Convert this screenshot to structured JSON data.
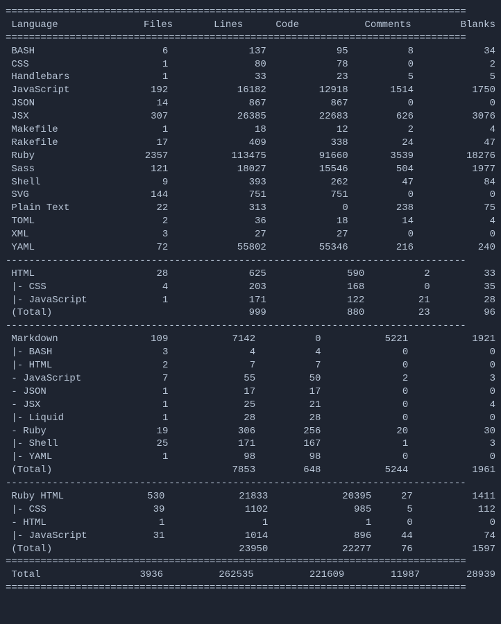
{
  "columns": [
    "Language",
    "Files",
    "Lines",
    "Code",
    "Comments",
    "Blanks"
  ],
  "sep_eq": "===============================================================================",
  "sep_dash": "-------------------------------------------------------------------------------",
  "sections": [
    {
      "rows": [
        {
          "label": "BASH",
          "files": 6,
          "lines": 137,
          "code": 95,
          "comments": 8,
          "blanks": 34
        },
        {
          "label": "CSS",
          "files": 1,
          "lines": 80,
          "code": 78,
          "comments": 0,
          "blanks": 2
        },
        {
          "label": "Handlebars",
          "files": 1,
          "lines": 33,
          "code": 23,
          "comments": 5,
          "blanks": 5
        },
        {
          "label": "JavaScript",
          "files": 192,
          "lines": 16182,
          "code": 12918,
          "comments": 1514,
          "blanks": 1750
        },
        {
          "label": "JSON",
          "files": 14,
          "lines": 867,
          "code": 867,
          "comments": 0,
          "blanks": 0
        },
        {
          "label": "JSX",
          "files": 307,
          "lines": 26385,
          "code": 22683,
          "comments": 626,
          "blanks": 3076
        },
        {
          "label": "Makefile",
          "files": 1,
          "lines": 18,
          "code": 12,
          "comments": 2,
          "blanks": 4
        },
        {
          "label": "Rakefile",
          "files": 17,
          "lines": 409,
          "code": 338,
          "comments": 24,
          "blanks": 47
        },
        {
          "label": "Ruby",
          "files": 2357,
          "lines": 113475,
          "code": 91660,
          "comments": 3539,
          "blanks": 18276
        },
        {
          "label": "Sass",
          "files": 121,
          "lines": 18027,
          "code": 15546,
          "comments": 504,
          "blanks": 1977
        },
        {
          "label": "Shell",
          "files": 9,
          "lines": 393,
          "code": 262,
          "comments": 47,
          "blanks": 84
        },
        {
          "label": "SVG",
          "files": 144,
          "lines": 751,
          "code": 751,
          "comments": 0,
          "blanks": 0
        },
        {
          "label": "Plain Text",
          "files": 22,
          "lines": 313,
          "code": 0,
          "comments": 238,
          "blanks": 75
        },
        {
          "label": "TOML",
          "files": 2,
          "lines": 36,
          "code": 18,
          "comments": 14,
          "blanks": 4
        },
        {
          "label": "XML",
          "files": 3,
          "lines": 27,
          "code": 27,
          "comments": 0,
          "blanks": 0
        },
        {
          "label": "YAML",
          "files": 72,
          "lines": 55802,
          "code": 55346,
          "comments": 216,
          "blanks": 240
        }
      ]
    },
    {
      "rows": [
        {
          "label": "HTML",
          "files": 28,
          "lines": 625,
          "code": 590,
          "comments": 2,
          "blanks": 33
        },
        {
          "label": "CSS",
          "indent": true,
          "files": 4,
          "lines": 203,
          "code": 168,
          "comments": 0,
          "blanks": 35
        },
        {
          "label": "JavaScript",
          "indent": true,
          "files": 1,
          "lines": 171,
          "code": 122,
          "comments": 21,
          "blanks": 28
        },
        {
          "label": "(Total)",
          "files": "",
          "lines": 999,
          "code": 880,
          "comments": 23,
          "blanks": 96
        }
      ]
    },
    {
      "rows": [
        {
          "label": "Markdown",
          "files": 109,
          "lines": 7142,
          "code": 0,
          "comments": 5221,
          "blanks": 1921
        },
        {
          "label": "BASH",
          "indent": true,
          "files": 3,
          "lines": 4,
          "code": 4,
          "comments": 0,
          "blanks": 0
        },
        {
          "label": "HTML",
          "indent": true,
          "files": 2,
          "lines": 7,
          "code": 7,
          "comments": 0,
          "blanks": 0
        },
        {
          "label": "JavaScript",
          "nest": true,
          "files": 7,
          "lines": 55,
          "code": 50,
          "comments": 2,
          "blanks": 3
        },
        {
          "label": "JSON",
          "nest": true,
          "files": 1,
          "lines": 17,
          "code": 17,
          "comments": 0,
          "blanks": 0
        },
        {
          "label": "JSX",
          "nest": true,
          "files": 1,
          "lines": 25,
          "code": 21,
          "comments": 0,
          "blanks": 4
        },
        {
          "label": "Liquid",
          "indent": true,
          "files": 1,
          "lines": 28,
          "code": 28,
          "comments": 0,
          "blanks": 0
        },
        {
          "label": "Ruby",
          "nest": true,
          "files": 19,
          "lines": 306,
          "code": 256,
          "comments": 20,
          "blanks": 30
        },
        {
          "label": "Shell",
          "indent": true,
          "files": 25,
          "lines": 171,
          "code": 167,
          "comments": 1,
          "blanks": 3
        },
        {
          "label": "YAML",
          "indent": true,
          "files": 1,
          "lines": 98,
          "code": 98,
          "comments": 0,
          "blanks": 0
        },
        {
          "label": "(Total)",
          "files": "",
          "lines": 7853,
          "code": 648,
          "comments": 5244,
          "blanks": 1961
        }
      ]
    },
    {
      "rows": [
        {
          "label": "Ruby HTML",
          "files": 530,
          "lines": 21833,
          "code": 20395,
          "comments": 27,
          "blanks": 1411
        },
        {
          "label": "CSS",
          "indent": true,
          "files": 39,
          "lines": 1102,
          "code": 985,
          "comments": 5,
          "blanks": 112
        },
        {
          "label": "HTML",
          "nest": true,
          "files": 1,
          "lines": 1,
          "code": 1,
          "comments": 0,
          "blanks": 0
        },
        {
          "label": "JavaScript",
          "indent": true,
          "files": 31,
          "lines": 1014,
          "code": 896,
          "comments": 44,
          "blanks": 74
        },
        {
          "label": "(Total)",
          "files": "",
          "lines": 23950,
          "code": 22277,
          "comments": 76,
          "blanks": 1597
        }
      ]
    }
  ],
  "total": {
    "label": "Total",
    "files": 3936,
    "lines": 262535,
    "code": 221609,
    "comments": 11987,
    "blanks": 28939
  }
}
